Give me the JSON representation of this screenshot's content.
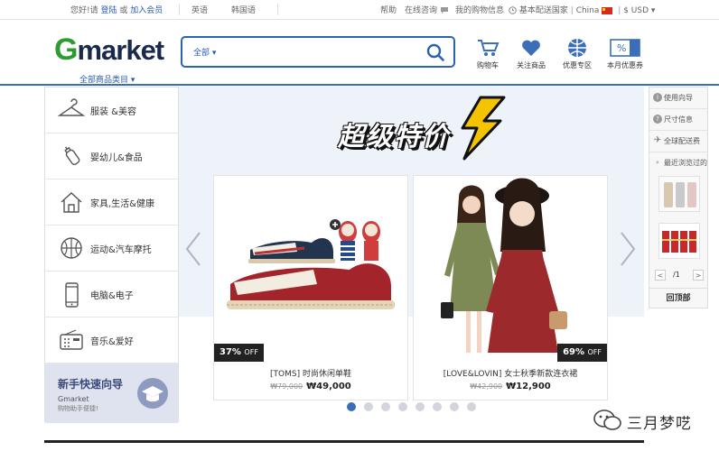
{
  "topbar": {
    "greeting": "您好!请",
    "login": "登陆",
    "or": "或",
    "join": "加入会员",
    "lang_en": "英语",
    "lang_ko": "韩国语",
    "help": "帮助",
    "online_consult": "在线咨询",
    "my_shopping": "我的购物信息",
    "delivery_country": "基本配送国家",
    "country": "China",
    "currency": "$ USD"
  },
  "header": {
    "logo_g": "G",
    "logo_rest": "market",
    "all_categories": "全部商品类目",
    "search_scope": "全部",
    "search_value": "",
    "icons": [
      {
        "label": "购物车"
      },
      {
        "label": "关注商品"
      },
      {
        "label": "优惠专区"
      },
      {
        "label": "本月优惠券"
      }
    ]
  },
  "leftnav": {
    "items": [
      {
        "label": "服装 &美容"
      },
      {
        "label": "婴幼儿&食品"
      },
      {
        "label": "家具,生活&健康"
      },
      {
        "label": "运动&汽车摩托"
      },
      {
        "label": "电脑&电子"
      },
      {
        "label": "音乐&爱好"
      }
    ],
    "guide": {
      "title": "新手快速向导",
      "brand": "Gmarket",
      "subtitle": "购物助手便捷!"
    }
  },
  "banner": {
    "headline": "超级特价",
    "products": [
      {
        "discount": "37%",
        "off": "OFF",
        "name": "[TOMS] 时尚休闲单鞋",
        "old_price": "₩79,000",
        "price": "₩49,000"
      },
      {
        "discount": "69%",
        "off": "OFF",
        "name": "[LOVE&LOVIN] 女士秋季新款连衣裙",
        "old_price": "₩42,900",
        "price": "₩12,900"
      }
    ],
    "dots_total": 8,
    "dots_active": 0
  },
  "rightpanel": {
    "items": [
      {
        "label": "使用向导"
      },
      {
        "label": "尺寸信息"
      },
      {
        "label": "全球配送费"
      },
      {
        "label": "最近浏览过的"
      }
    ],
    "pager_prev": "<",
    "pager_page": "/1",
    "pager_next": ">",
    "back_top": "回顶部"
  },
  "watermark": "三月梦呓",
  "colors": {
    "accent": "#3b6eb8",
    "logo_green": "#2d9b2f",
    "banner_bg": "#eef3fa"
  }
}
